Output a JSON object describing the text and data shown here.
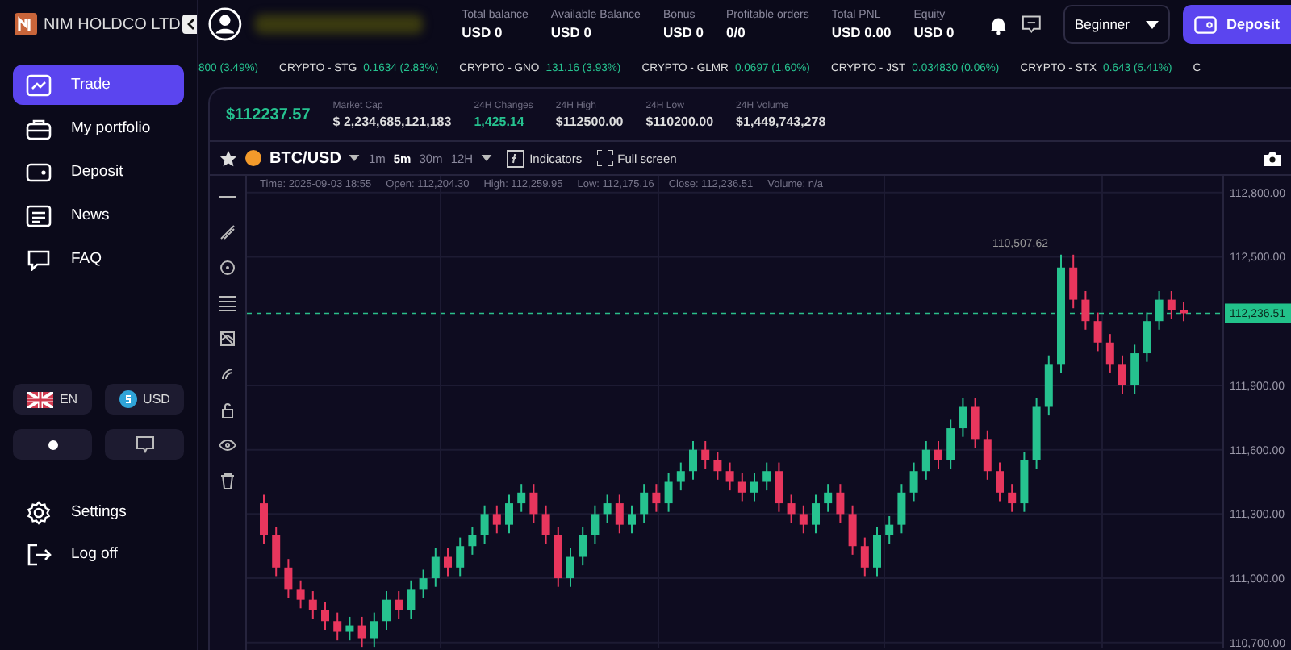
{
  "brand": {
    "name": "NIM HOLDCO LTD"
  },
  "nav": [
    {
      "label": "Trade",
      "selected": true
    },
    {
      "label": "My portfolio",
      "selected": false
    },
    {
      "label": "Deposit",
      "selected": false
    },
    {
      "label": "News",
      "selected": false
    },
    {
      "label": "FAQ",
      "selected": false
    }
  ],
  "language": "EN",
  "currency": "USD",
  "bottom_nav": [
    {
      "label": "Settings"
    },
    {
      "label": "Log off"
    }
  ],
  "balances": [
    {
      "label": "Total balance",
      "value": "USD 0"
    },
    {
      "label": "Available Balance",
      "value": "USD 0"
    },
    {
      "label": "Bonus",
      "value": "USD 0"
    },
    {
      "label": "Profitable orders",
      "value": "0/0"
    },
    {
      "label": "Total PNL",
      "value": "USD 0.00"
    },
    {
      "label": "Equity",
      "value": "USD 0"
    }
  ],
  "level_select": "Beginner",
  "deposit_button": "Deposit",
  "ticker": [
    {
      "quote": "800 (3.49%)"
    },
    {
      "name": "CRYPTO - STG",
      "quote": "0.1634 (2.83%)"
    },
    {
      "name": "CRYPTO - GNO",
      "quote": "131.16 (3.93%)"
    },
    {
      "name": "CRYPTO - GLMR",
      "quote": "0.0697 (1.60%)"
    },
    {
      "name": "CRYPTO - JST",
      "quote": "0.034830 (0.06%)"
    },
    {
      "name": "CRYPTO - STX",
      "quote": "0.643 (5.41%)"
    },
    {
      "name": "C"
    }
  ],
  "market": {
    "price": "$112237.57",
    "stats": [
      {
        "label": "Market Cap",
        "value": "$ 2,234,685,121,183",
        "positive": false
      },
      {
        "label": "24H Changes",
        "value": "1,425.14",
        "positive": true
      },
      {
        "label": "24H High",
        "value": "$112500.00",
        "positive": false
      },
      {
        "label": "24H Low",
        "value": "$110200.00",
        "positive": false
      },
      {
        "label": "24H Volume",
        "value": "$1,449,743,278",
        "positive": false
      }
    ]
  },
  "chart_toolbar": {
    "pair": "BTC/USD",
    "intervals": [
      {
        "label": "1m",
        "selected": false
      },
      {
        "label": "5m",
        "selected": true
      },
      {
        "label": "30m",
        "selected": false
      },
      {
        "label": "12H",
        "selected": false
      }
    ],
    "indicators": "Indicators",
    "fullscreen": "Full screen"
  },
  "ohlc": [
    "Time: 2025-09-03 18:55",
    "Open: 112,204.30",
    "High: 112,259.95",
    "Low: 112,175.16",
    "Close: 112,236.51",
    "Volume: n/a"
  ],
  "chart_data": {
    "type": "candlestick",
    "ylim": [
      110673,
      112878
    ],
    "yticks": [
      {
        "value": 112800,
        "label": "112,800.00"
      },
      {
        "value": 112500,
        "label": "112,500.00"
      },
      {
        "value": 111900,
        "label": "111,900.00"
      },
      {
        "value": 111600,
        "label": "111,600.00"
      },
      {
        "value": 111300,
        "label": "111,300.00"
      },
      {
        "value": 111000,
        "label": "111,000.00"
      },
      {
        "value": 110700,
        "label": "110,700.00"
      }
    ],
    "ohlc": [
      [
        111350,
        111390,
        111160,
        111200
      ],
      [
        111200,
        111240,
        111010,
        111050
      ],
      [
        111050,
        111090,
        110910,
        110950
      ],
      [
        110950,
        110990,
        110860,
        110900
      ],
      [
        110900,
        110940,
        110810,
        110850
      ],
      [
        110850,
        110890,
        110760,
        110800
      ],
      [
        110800,
        110840,
        110710,
        110750
      ],
      [
        110750,
        110820,
        110710,
        110780
      ],
      [
        110780,
        110820,
        110680,
        110720
      ],
      [
        110720,
        110840,
        110680,
        110800
      ],
      [
        110800,
        110940,
        110760,
        110900
      ],
      [
        110900,
        110940,
        110810,
        110850
      ],
      [
        110850,
        110990,
        110810,
        110950
      ],
      [
        110950,
        111040,
        110910,
        111000
      ],
      [
        111000,
        111140,
        110960,
        111100
      ],
      [
        111100,
        111140,
        111010,
        111050
      ],
      [
        111050,
        111190,
        111010,
        111150
      ],
      [
        111150,
        111240,
        111110,
        111200
      ],
      [
        111200,
        111340,
        111160,
        111300
      ],
      [
        111300,
        111340,
        111210,
        111250
      ],
      [
        111250,
        111390,
        111210,
        111350
      ],
      [
        111350,
        111440,
        111310,
        111400
      ],
      [
        111400,
        111440,
        111260,
        111300
      ],
      [
        111300,
        111340,
        111160,
        111200
      ],
      [
        111200,
        111240,
        110960,
        111000
      ],
      [
        111000,
        111140,
        110960,
        111100
      ],
      [
        111100,
        111240,
        111060,
        111200
      ],
      [
        111200,
        111340,
        111160,
        111300
      ],
      [
        111300,
        111390,
        111260,
        111350
      ],
      [
        111350,
        111390,
        111210,
        111250
      ],
      [
        111250,
        111340,
        111210,
        111300
      ],
      [
        111300,
        111440,
        111260,
        111400
      ],
      [
        111400,
        111440,
        111310,
        111350
      ],
      [
        111350,
        111490,
        111310,
        111450
      ],
      [
        111450,
        111540,
        111410,
        111500
      ],
      [
        111500,
        111640,
        111460,
        111600
      ],
      [
        111600,
        111640,
        111510,
        111550
      ],
      [
        111550,
        111590,
        111460,
        111500
      ],
      [
        111500,
        111540,
        111410,
        111450
      ],
      [
        111450,
        111490,
        111360,
        111400
      ],
      [
        111400,
        111490,
        111360,
        111450
      ],
      [
        111450,
        111540,
        111410,
        111500
      ],
      [
        111500,
        111540,
        111310,
        111350
      ],
      [
        111350,
        111390,
        111260,
        111300
      ],
      [
        111300,
        111340,
        111210,
        111250
      ],
      [
        111250,
        111390,
        111210,
        111350
      ],
      [
        111350,
        111440,
        111310,
        111400
      ],
      [
        111400,
        111440,
        111260,
        111300
      ],
      [
        111300,
        111340,
        111110,
        111150
      ],
      [
        111150,
        111190,
        111010,
        111050
      ],
      [
        111050,
        111240,
        111010,
        111200
      ],
      [
        111200,
        111290,
        111160,
        111250
      ],
      [
        111250,
        111440,
        111210,
        111400
      ],
      [
        111400,
        111540,
        111360,
        111500
      ],
      [
        111500,
        111640,
        111460,
        111600
      ],
      [
        111600,
        111640,
        111510,
        111550
      ],
      [
        111550,
        111740,
        111510,
        111700
      ],
      [
        111700,
        111840,
        111660,
        111800
      ],
      [
        111800,
        111840,
        111610,
        111650
      ],
      [
        111650,
        111690,
        111460,
        111500
      ],
      [
        111500,
        111540,
        111360,
        111400
      ],
      [
        111400,
        111440,
        111310,
        111350
      ],
      [
        111350,
        111590,
        111310,
        111550
      ],
      [
        111550,
        111840,
        111510,
        111800
      ],
      [
        111800,
        112040,
        111760,
        112000
      ],
      [
        112000,
        112510,
        111960,
        112450
      ],
      [
        112450,
        112510,
        112260,
        112300
      ],
      [
        112300,
        112340,
        112160,
        112200
      ],
      [
        112200,
        112240,
        112060,
        112100
      ],
      [
        112100,
        112140,
        111960,
        112000
      ],
      [
        112000,
        112040,
        111860,
        111900
      ],
      [
        111900,
        112090,
        111860,
        112050
      ],
      [
        112050,
        112240,
        112010,
        112200
      ],
      [
        112200,
        112340,
        112160,
        112300
      ],
      [
        112300,
        112340,
        112210,
        112250
      ],
      [
        112250,
        112290,
        112200,
        112236.51
      ]
    ],
    "grid": true,
    "ref_lines": [
      {
        "axis": "y",
        "value": 112236.51,
        "label": "112,236.51"
      }
    ],
    "annotations": [
      "110,507.62"
    ]
  }
}
